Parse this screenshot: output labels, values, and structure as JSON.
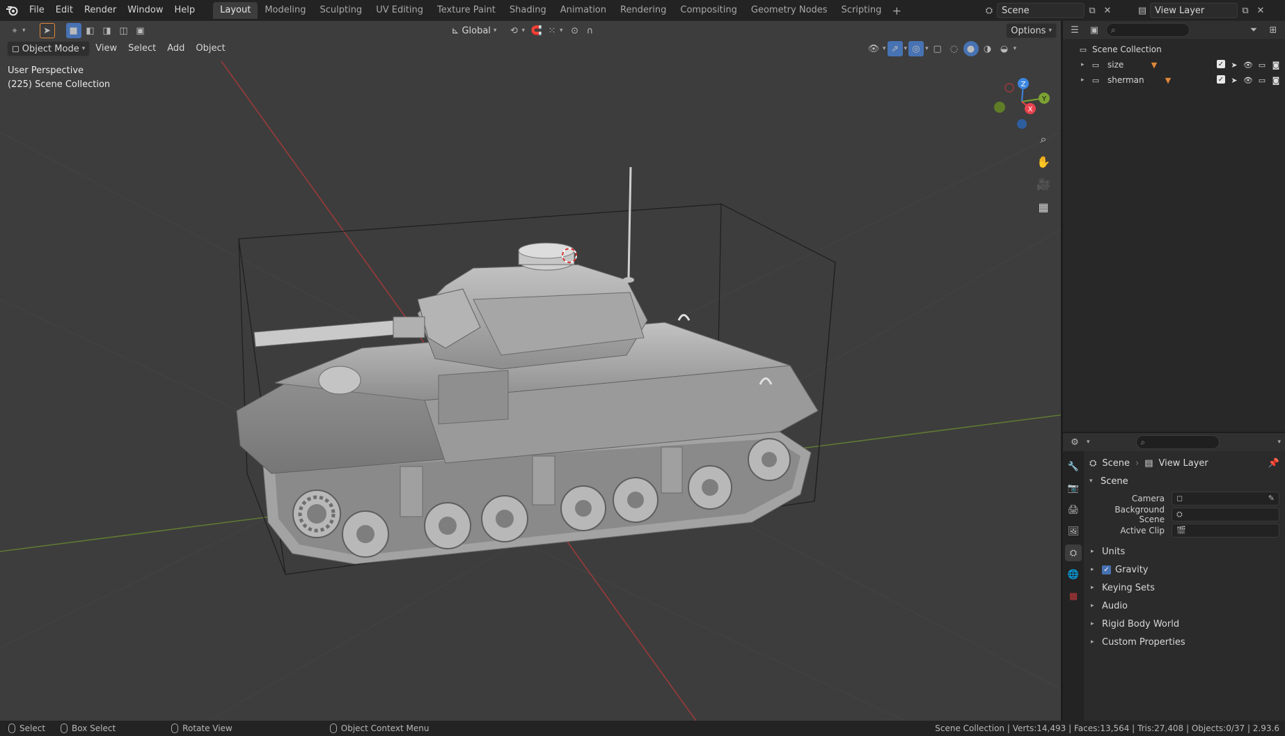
{
  "menu": [
    "File",
    "Edit",
    "Render",
    "Window",
    "Help"
  ],
  "workspaces": [
    "Layout",
    "Modeling",
    "Sculpting",
    "UV Editing",
    "Texture Paint",
    "Shading",
    "Animation",
    "Rendering",
    "Compositing",
    "Geometry Nodes",
    "Scripting"
  ],
  "active_workspace": "Layout",
  "scene_name": "Scene",
  "view_layer_name": "View Layer",
  "viewport": {
    "mode": "Object Mode",
    "menus": [
      "View",
      "Select",
      "Add",
      "Object"
    ],
    "orientation": "Global",
    "options_label": "Options",
    "perspective_label": "User Perspective",
    "collection_label": "(225) Scene Collection",
    "gizmo": {
      "x": "X",
      "y": "Y",
      "z": "Z"
    }
  },
  "outliner": {
    "root": "Scene Collection",
    "items": [
      {
        "name": "size"
      },
      {
        "name": "sherman"
      }
    ]
  },
  "properties": {
    "crumb_scene": "Scene",
    "crumb_view_layer": "View Layer",
    "panel_title": "Scene",
    "fields": [
      {
        "label": "Camera"
      },
      {
        "label": "Background Scene"
      },
      {
        "label": "Active Clip"
      }
    ],
    "subpanels": [
      {
        "label": "Units",
        "checkbox": false
      },
      {
        "label": "Gravity",
        "checkbox": true
      },
      {
        "label": "Keying Sets",
        "checkbox": false
      },
      {
        "label": "Audio",
        "checkbox": false
      },
      {
        "label": "Rigid Body World",
        "checkbox": false
      },
      {
        "label": "Custom Properties",
        "checkbox": false
      }
    ]
  },
  "statusbar": {
    "select": "Select",
    "box_select": "Box Select",
    "rotate_view": "Rotate View",
    "context_menu": "Object Context Menu",
    "stats": "Scene Collection | Verts:14,493 | Faces:13,564 | Tris:27,408 | Objects:0/37 | 2.93.6"
  },
  "colors": {
    "accent": "#4772b3",
    "x_axis": "#e8434f",
    "y_axis": "#7ca233",
    "z_axis": "#3c86e0",
    "object_orange": "#e0883a"
  }
}
